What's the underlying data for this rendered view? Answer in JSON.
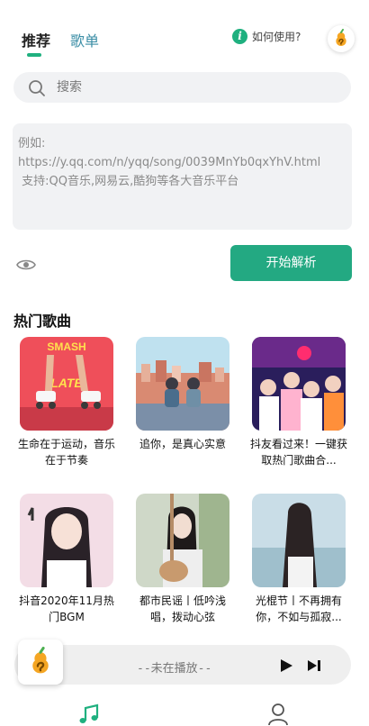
{
  "tabs": {
    "recommend": "推荐",
    "playlists": "歌单",
    "active_color": "#1fb07f"
  },
  "help": {
    "badge": "i",
    "label": "如何使用?"
  },
  "search": {
    "placeholder": "搜索"
  },
  "url_box": {
    "placeholder": "例如:\nhttps://y.qq.com/n/yqq/song/0039MnYb0qxYhV.html\n 支持:QQ音乐,网易云,酷狗等各大音乐平台"
  },
  "parse_button": {
    "label": "开始解析",
    "color": "#23a982"
  },
  "hot_songs": {
    "title": "热门歌曲",
    "items": [
      {
        "title": "生命在于运动，音乐在于节奏",
        "cover_text_1": "SMASH",
        "cover_text_2": "LATE"
      },
      {
        "title": "追你，是真心实意"
      },
      {
        "title": "抖友看过来！一键获取热门歌曲合..."
      },
      {
        "title": "抖音2020年11月热门BGM"
      },
      {
        "title": "都市民谣丨低吟浅唱，拨动心弦"
      },
      {
        "title": "光棍节丨不再拥有你，不如与孤寂..."
      }
    ]
  },
  "player": {
    "status": "--未在播放--"
  },
  "icons": {
    "help": "info-icon",
    "search": "search-icon",
    "visibility": "eye-icon",
    "play": "play-icon",
    "next": "skip-next-icon",
    "nav_music": "music-note-icon",
    "nav_user": "user-icon"
  }
}
